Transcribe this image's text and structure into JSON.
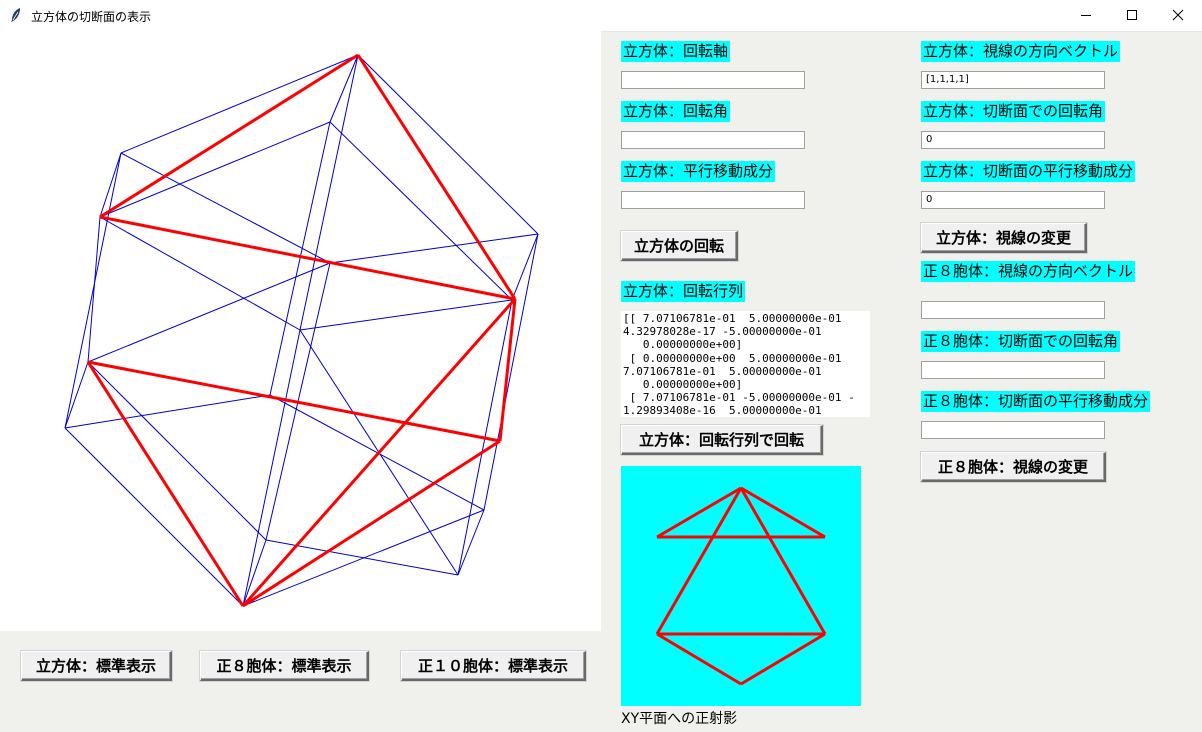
{
  "window": {
    "title": "立方体の切断面の表示",
    "icons": {
      "app": "feather-icon",
      "minimize": "minimize-icon",
      "maximize": "maximize-icon",
      "close": "close-icon"
    }
  },
  "buttons_bottom": {
    "cube_standard": "立方体：標準表示",
    "octahedron_standard": "正８胞体：標準表示",
    "decahedron_standard": "正１０胞体：標準表示"
  },
  "left_panel": {
    "rotation_axis": {
      "label": "立方体：回転軸",
      "value": ""
    },
    "rotation_angle": {
      "label": "立方体：回転角",
      "value": ""
    },
    "translation": {
      "label": "立方体：平行移動成分",
      "value": ""
    },
    "rotate_button": "立方体の回転",
    "rotation_matrix_label": "立方体：回転行列",
    "rotation_matrix_text": "[[ 7.07106781e-01  5.00000000e-01\n4.32978028e-17 -5.00000000e-01\n   0.00000000e+00]\n [ 0.00000000e+00  5.00000000e-01\n7.07106781e-01  5.00000000e-01\n   0.00000000e+00]\n [ 7.07106781e-01 -5.00000000e-01 -\n1.29893408e-16  5.00000000e-01",
    "rotate_by_matrix_button": "立方体：回転行列で回転",
    "projection_caption": "XY平面への正射影"
  },
  "right_panel": {
    "cube_view_vector": {
      "label": "立方体：視線の方向ベクトル",
      "value": "[1,1,1,1]"
    },
    "cube_section_angle": {
      "label": "立方体：切断面での回転角",
      "value": "0"
    },
    "cube_section_translation": {
      "label": "立方体：切断面の平行移動成分",
      "value": "0"
    },
    "cube_view_button": "立方体：視線の変更",
    "oct_view_vector": {
      "label": "正８胞体：視線の方向ベクトル",
      "value": ""
    },
    "oct_section_angle": {
      "label": "正８胞体：切断面での回転角",
      "value": ""
    },
    "oct_section_translation": {
      "label": "正８胞体：切断面の平行移動成分",
      "value": ""
    },
    "oct_view_button": "正８胞体：視線の変更"
  },
  "colors": {
    "wireframe": "#0000cc",
    "section": "#ff0000",
    "label_bg": "#00ffff",
    "projection_bg": "#00ffff"
  }
}
